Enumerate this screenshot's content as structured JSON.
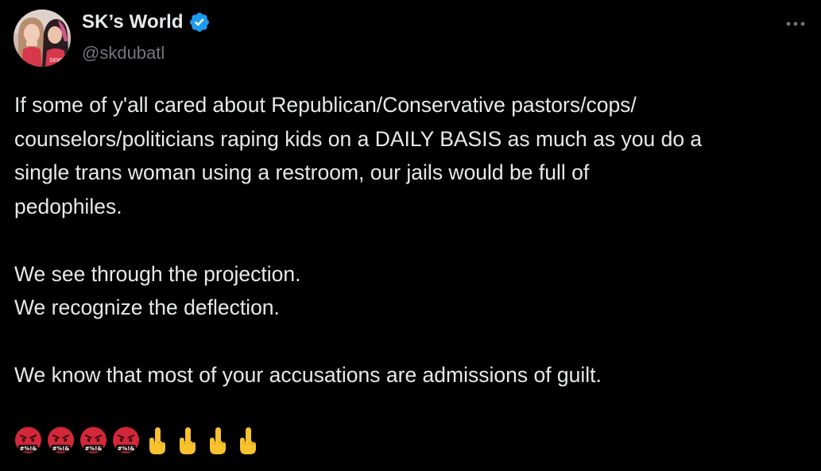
{
  "author": {
    "display_name": "SK’s World",
    "handle": "@skdubatl",
    "verified": true,
    "avatar_icon": "avatar-photo-two-women",
    "verified_color": "#1d9bf0"
  },
  "menu": {
    "more_icon": "more-horizontal-icon"
  },
  "tweet": {
    "paragraphs": [
      {
        "lines": [
          "If some of y'all cared about Republican/Conservative pastors/cops/",
          "counselors/politicians raping kids on a DAILY BASIS as much as you do a",
          "single trans woman using a restroom, our jails would be full of",
          "pedophiles."
        ]
      },
      {
        "lines": [
          "We see through the projection.",
          "We recognize the deflection."
        ]
      },
      {
        "lines": [
          "We know that most of your accusations are admissions of guilt."
        ]
      }
    ],
    "emojis": [
      "face-with-symbols-on-mouth",
      "face-with-symbols-on-mouth",
      "face-with-symbols-on-mouth",
      "face-with-symbols-on-mouth",
      "middle-finger",
      "middle-finger",
      "middle-finger",
      "middle-finger"
    ]
  },
  "colors": {
    "background": "#000000",
    "text_primary": "#e7e9ea",
    "text_secondary": "#71767b"
  }
}
